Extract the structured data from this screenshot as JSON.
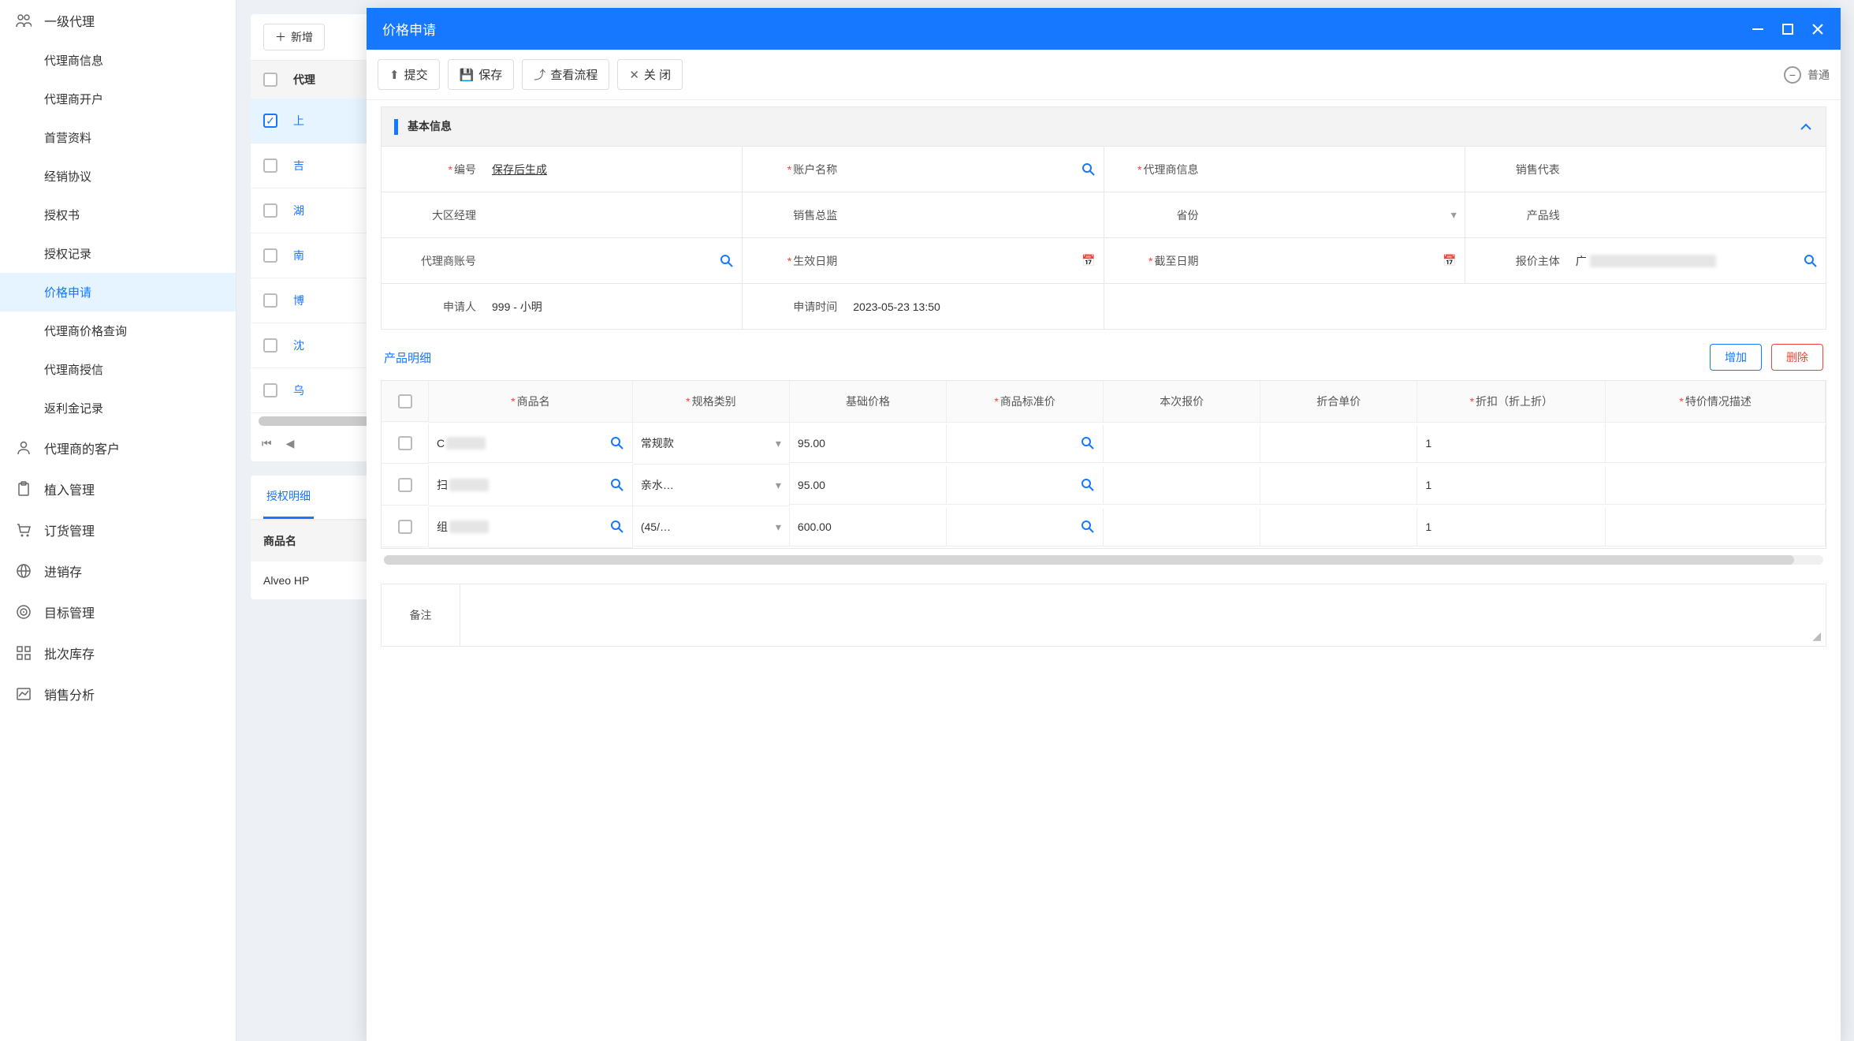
{
  "sidebar": {
    "groups": [
      {
        "label": "一级代理",
        "icon": "people",
        "children": [
          "代理商信息",
          "代理商开户",
          "首营资料",
          "经销协议",
          "授权书",
          "授权记录",
          "价格申请",
          "代理商价格查询",
          "代理商授信",
          "返利金记录"
        ],
        "activeIndex": 6
      },
      {
        "label": "代理商的客户",
        "icon": "person"
      },
      {
        "label": "植入管理",
        "icon": "clipboard"
      },
      {
        "label": "订货管理",
        "icon": "cart"
      },
      {
        "label": "进销存",
        "icon": "globe"
      },
      {
        "label": "目标管理",
        "icon": "target"
      },
      {
        "label": "批次库存",
        "icon": "grid"
      },
      {
        "label": "销售分析",
        "icon": "chart"
      }
    ]
  },
  "bg": {
    "addLabel": "新增",
    "headerCol": "代理",
    "rows": [
      "上",
      "吉",
      "湖",
      "南",
      "博",
      "沈",
      "乌"
    ],
    "selectedIndex": 0,
    "subTab": "授权明细",
    "subHeader": "商品名",
    "subRow": "Alveo HP"
  },
  "modal": {
    "title": "价格申请",
    "toolbar": {
      "submit": "提交",
      "save": "保存",
      "viewFlow": "查看流程",
      "close": "关 闭",
      "chip": "普通"
    },
    "section": {
      "title": "基本信息"
    },
    "form": {
      "code": {
        "label": "编号",
        "value": "保存后生成",
        "required": true
      },
      "acctName": {
        "label": "账户名称",
        "required": true
      },
      "agentInfo": {
        "label": "代理商信息",
        "required": true
      },
      "salesRep": {
        "label": "销售代表"
      },
      "regionMgr": {
        "label": "大区经理"
      },
      "salesDir": {
        "label": "销售总监"
      },
      "province": {
        "label": "省份"
      },
      "productLine": {
        "label": "产品线"
      },
      "agentAcct": {
        "label": "代理商账号"
      },
      "effDate": {
        "label": "生效日期",
        "required": true
      },
      "endDate": {
        "label": "截至日期",
        "required": true
      },
      "quoteEntity": {
        "label": "报价主体",
        "value": "广"
      },
      "applicant": {
        "label": "申请人",
        "value": "999 - 小明"
      },
      "applyTime": {
        "label": "申请时间",
        "value": "2023-05-23 13:50"
      }
    },
    "detail": {
      "tab": "产品明细",
      "addBtn": "增加",
      "delBtn": "删除",
      "headers": {
        "name": "商品名",
        "spec": "规格类别",
        "basePrice": "基础价格",
        "stdPrice": "商品标准价",
        "thisQuote": "本次报价",
        "unitPrice": "折合单价",
        "discount": "折扣（折上折）",
        "specialDesc": "特价情况描述"
      },
      "rows": [
        {
          "name": "C",
          "spec": "常规款",
          "basePrice": "95.00",
          "discount": "1"
        },
        {
          "name": "扫",
          "spec": "亲水…",
          "basePrice": "95.00",
          "discount": "1"
        },
        {
          "name": "组",
          "spec": "(45/…",
          "basePrice": "600.00",
          "discount": "1"
        }
      ]
    },
    "remarkLabel": "备注"
  }
}
